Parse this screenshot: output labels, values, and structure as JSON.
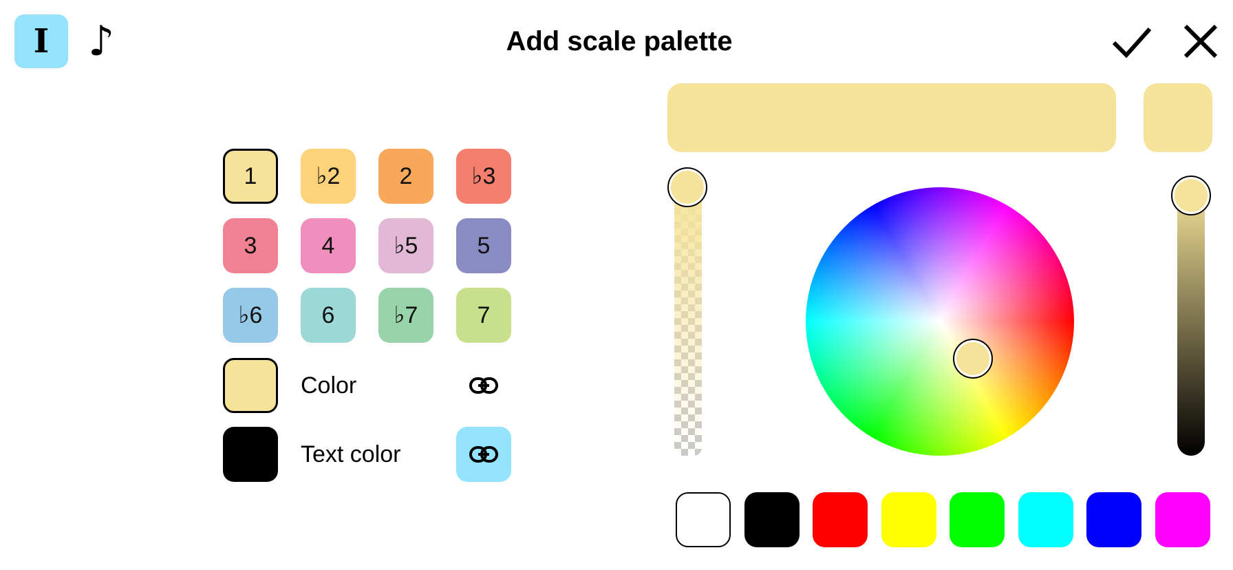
{
  "header": {
    "title": "Add scale palette",
    "mode_button_label": "I",
    "note_button_label": "♪",
    "confirm_icon": "check-icon",
    "close_icon": "close-icon"
  },
  "palette": {
    "degrees": [
      {
        "label": "1",
        "color": "#f6e39a",
        "selected": true
      },
      {
        "label": "♭2",
        "color": "#fdd27a"
      },
      {
        "label": "2",
        "color": "#f8a858"
      },
      {
        "label": "♭3",
        "color": "#f47f6f"
      },
      {
        "label": "3",
        "color": "#f18192"
      },
      {
        "label": "4",
        "color": "#f08fbd"
      },
      {
        "label": "♭5",
        "color": "#e2b8d5"
      },
      {
        "label": "5",
        "color": "#8b8bc4"
      },
      {
        "label": "♭6",
        "color": "#96c9e7"
      },
      {
        "label": "6",
        "color": "#9dd8d9"
      },
      {
        "label": "♭7",
        "color": "#98d3a9"
      },
      {
        "label": "7",
        "color": "#c8df8b"
      }
    ],
    "color_label": "Color",
    "color_value": "#f6e39a",
    "text_color_label": "Text color",
    "text_color_value": "#000000",
    "link_icon": "link-icon"
  },
  "picker": {
    "current_color": "#f6e39a",
    "accent": "#92e3fb",
    "presets": [
      "#ffffff",
      "#000000",
      "#ff0000",
      "#ffff00",
      "#00ff00",
      "#00ffff",
      "#0000ff",
      "#ff00ff"
    ]
  }
}
